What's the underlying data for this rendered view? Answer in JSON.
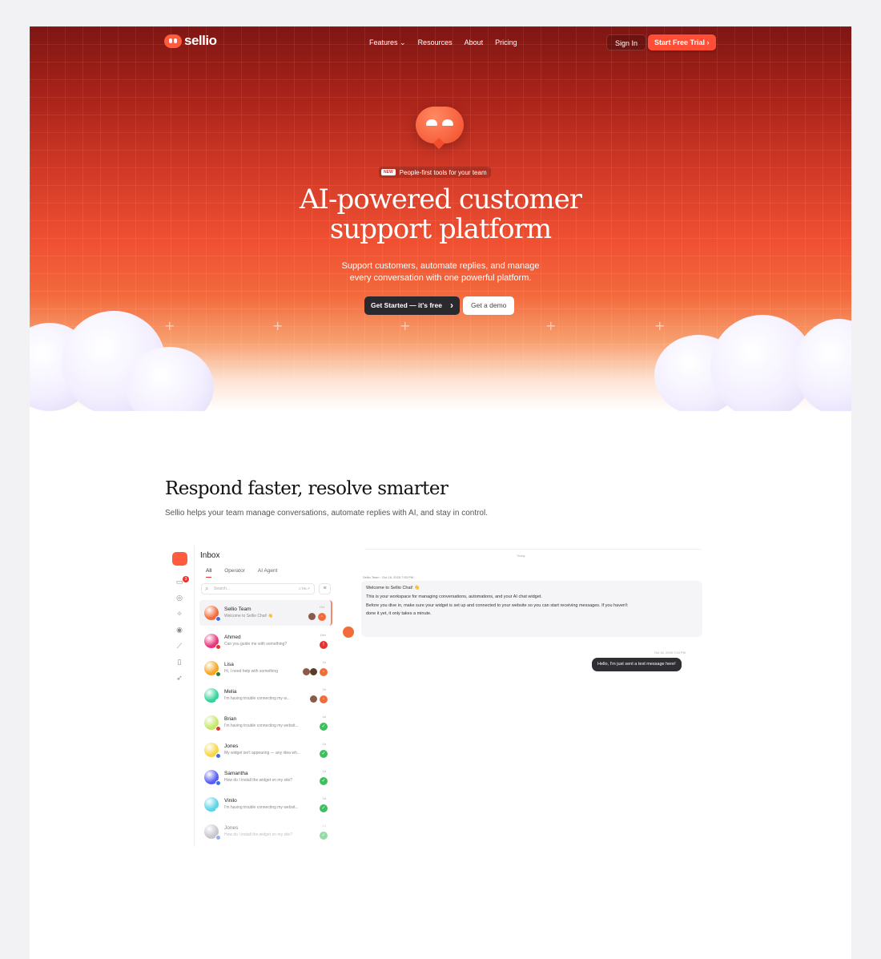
{
  "nav": {
    "logo": "sellio",
    "menu": [
      "Features ⌄",
      "Resources",
      "About",
      "Pricing"
    ],
    "sign_in": "Sign In",
    "start_trial": "Start Free Trial  ›"
  },
  "hero": {
    "badge_new": "NEW",
    "badge_text": "People-first tools for your team",
    "title_line1": "AI-powered customer",
    "title_line2": "support platform",
    "subtitle_line1": "Support customers, automate replies, and manage",
    "subtitle_line2": "every conversation with one powerful platform.",
    "cta_primary": "Get Started — it's free",
    "cta_secondary": "Get a demo"
  },
  "section": {
    "title": "Respond faster, resolve smarter",
    "subtitle": "Sellio helps your team manage conversations, automate replies with AI, and stay in control."
  },
  "app": {
    "inbox_title": "Inbox",
    "unread_count": "3",
    "tabs": [
      "All",
      "Operator",
      "AI Agent"
    ],
    "search_placeholder": "Search...",
    "search_shortcut": "CTRL F",
    "conversations": [
      {
        "name": "Sellio Team",
        "message": "Welcome to Sellio Chat! 👋",
        "time": "Oct",
        "color": "#f26b3a",
        "dot": "#3a6ee8",
        "status": "hot"
      },
      {
        "name": "Ahmed",
        "message": "Can you guide me with something?",
        "time": "18m",
        "color": "#e8347a",
        "dot": "#e33434",
        "status": "red"
      },
      {
        "name": "Lisa",
        "message": "Hi, I need help with something",
        "time": "1h",
        "color": "#f5a623",
        "dot": "#2e7d32",
        "status": "hot"
      },
      {
        "name": "Melia",
        "message": "I'm having trouble connecting my w...",
        "time": "2h",
        "color": "#35d39a",
        "dot": "#ffffff",
        "status": "hot"
      },
      {
        "name": "Brian",
        "message": "I'm having trouble connecting my websit...",
        "time": "4d",
        "color": "#c4e86a",
        "dot": "#e33434",
        "status": "ok"
      },
      {
        "name": "Jones",
        "message": "My widget isn't appearing — any idea wh...",
        "time": "1d",
        "color": "#f7d64a",
        "dot": "#3a6ee8",
        "status": "ok"
      },
      {
        "name": "Samantha",
        "message": "How do I install the widget on my site?",
        "time": "1d",
        "color": "#5a5ef0",
        "dot": "#3a6ee8",
        "status": "ok"
      },
      {
        "name": "Vinilo",
        "message": "I'm having trouble connecting my websit...",
        "time": "2d",
        "color": "#5ad4e6",
        "dot": "#ffffff",
        "status": "ok"
      },
      {
        "name": "Jones",
        "message": "How do I install the widget on my site?",
        "time": "1d",
        "color": "#9a9aa6",
        "dot": "#3a6ee8",
        "status": "ok"
      }
    ],
    "chat": {
      "day_label": "Today",
      "sender_line": "Sellio Team · Oct 16, 2025 7:53 PM",
      "msg_line1": "Welcome to Sellio Chat! 👋",
      "msg_line2": "This is your workspace for managing conversations, automations, and your AI chat widget.",
      "msg_line3": "Before you dive in, make sure your widget is set up and connected to your website so you can start receiving messages. If you haven't",
      "msg_line4": "done it yet, it only takes a minute.",
      "reply_time": "Oct 16, 2025 7:53 PM",
      "reply_text": "Hello, I'm just sent a test message here!"
    }
  },
  "colors": {
    "accent": "#ff4d36",
    "hero_dark": "#7e1613",
    "dark_button": "#2a2a2e"
  }
}
